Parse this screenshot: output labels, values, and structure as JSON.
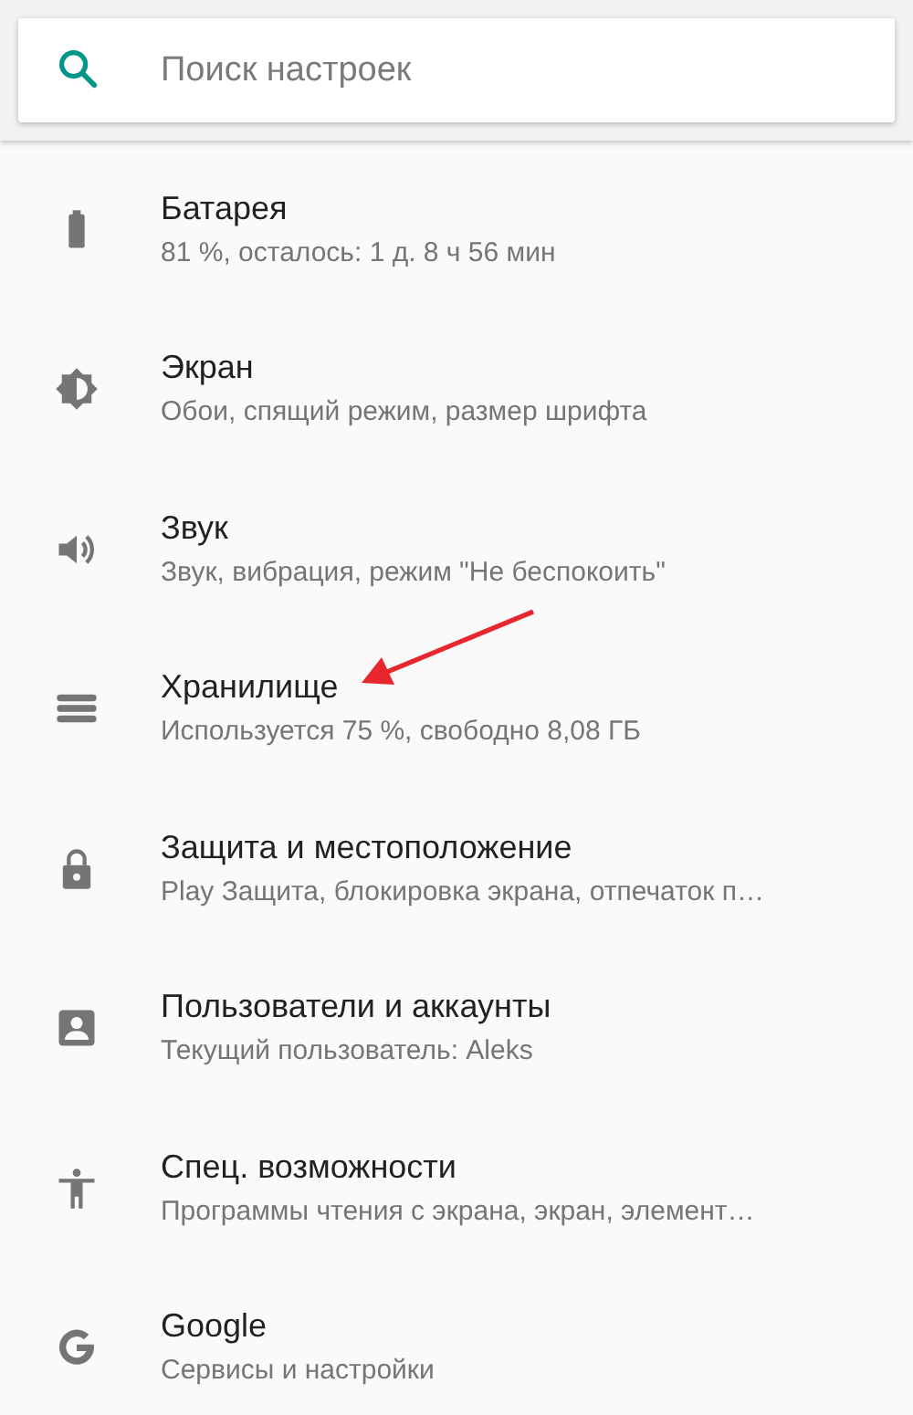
{
  "search": {
    "placeholder": "Поиск настроек"
  },
  "items": [
    {
      "title": "Батарея",
      "subtitle": "81 %, осталось: 1 д. 8 ч 56 мин",
      "highlighted": false
    },
    {
      "title": "Экран",
      "subtitle": "Обои, спящий режим, размер шрифта",
      "highlighted": false
    },
    {
      "title": "Звук",
      "subtitle": "Звук, вибрация, режим \"Не беспокоить\"",
      "highlighted": false
    },
    {
      "title": "Хранилище",
      "subtitle": "Используется 75 %, свободно 8,08 ГБ",
      "highlighted": true
    },
    {
      "title": "Защита и местоположение",
      "subtitle": "Play Защита, блокировка экрана, отпечаток п…",
      "highlighted": false
    },
    {
      "title": "Пользователи и аккаунты",
      "subtitle": "Текущий пользователь: Aleks",
      "highlighted": false
    },
    {
      "title": "Спец. возможности",
      "subtitle": "Программы чтения с экрана, экран, элемент…",
      "highlighted": false
    },
    {
      "title": "Google",
      "subtitle": "Сервисы и настройки",
      "highlighted": false
    }
  ]
}
